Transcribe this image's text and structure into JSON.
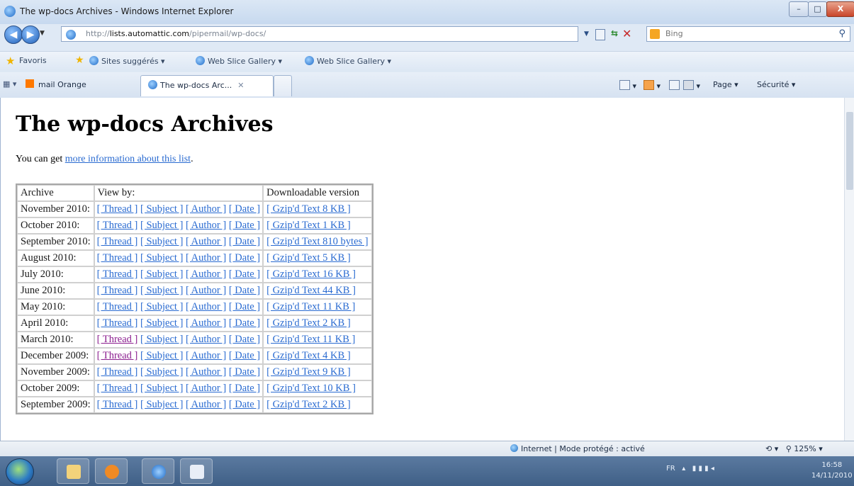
{
  "window": {
    "title": "The wp-docs Archives - Windows Internet Explorer",
    "minimize": "–",
    "maximize": "□",
    "close": "X"
  },
  "address": {
    "url_prefix": "http://",
    "url_host": "lists.automattic.com",
    "url_path": "/pipermail/wp-docs/",
    "search_placeholder": "Bing"
  },
  "favorites_bar": {
    "favorites_label": "Favoris",
    "items": [
      "Sites suggérés ▾",
      "Web Slice Gallery ▾",
      "Web Slice Gallery ▾"
    ]
  },
  "tabs": [
    {
      "label": "mail Orange"
    },
    {
      "label": "The wp-docs Arc...",
      "close": "✕"
    }
  ],
  "commands": {
    "page": "Page ▾",
    "security": "Sécurité ▾"
  },
  "page": {
    "title": "The wp-docs Archives",
    "intro_prefix": "You can get ",
    "intro_link": "more information about this list",
    "intro_suffix": ".",
    "table_headers": {
      "archive": "Archive",
      "view_by": "View by:",
      "download": "Downloadable version"
    },
    "link_labels": {
      "thread": "[ Thread ]",
      "subject": "[ Subject ]",
      "author": "[ Author ]",
      "date": "[ Date ]"
    },
    "rows": [
      {
        "month": "November 2010:",
        "download": "[ Gzip'd Text 8 KB ]",
        "thread_visited": false
      },
      {
        "month": "October 2010:",
        "download": "[ Gzip'd Text 1 KB ]",
        "thread_visited": false
      },
      {
        "month": "September 2010:",
        "download": "[ Gzip'd Text 810 bytes ]",
        "thread_visited": false
      },
      {
        "month": "August 2010:",
        "download": "[ Gzip'd Text 5 KB ]",
        "thread_visited": false
      },
      {
        "month": "July 2010:",
        "download": "[ Gzip'd Text 16 KB ]",
        "thread_visited": false
      },
      {
        "month": "June 2010:",
        "download": "[ Gzip'd Text 44 KB ]",
        "thread_visited": false
      },
      {
        "month": "May 2010:",
        "download": "[ Gzip'd Text 11 KB ]",
        "thread_visited": false
      },
      {
        "month": "April 2010:",
        "download": "[ Gzip'd Text 2 KB ]",
        "thread_visited": false
      },
      {
        "month": "March 2010:",
        "download": "[ Gzip'd Text 11 KB ]",
        "thread_visited": true
      },
      {
        "month": "December 2009:",
        "download": "[ Gzip'd Text 4 KB ]",
        "thread_visited": true
      },
      {
        "month": "November 2009:",
        "download": "[ Gzip'd Text 9 KB ]",
        "thread_visited": false
      },
      {
        "month": "October 2009:",
        "download": "[ Gzip'd Text 10 KB ]",
        "thread_visited": false
      },
      {
        "month": "September 2009:",
        "download": "[ Gzip'd Text 2 KB ]",
        "thread_visited": false
      }
    ]
  },
  "status": {
    "zone": "Internet | Mode protégé : activé",
    "zoom": "125%"
  },
  "taskbar": {
    "lang": "FR",
    "time": "16:58",
    "date": "14/11/2010"
  },
  "colors": {
    "link": "#2a6bd1",
    "visited": "#8b1e8f"
  }
}
